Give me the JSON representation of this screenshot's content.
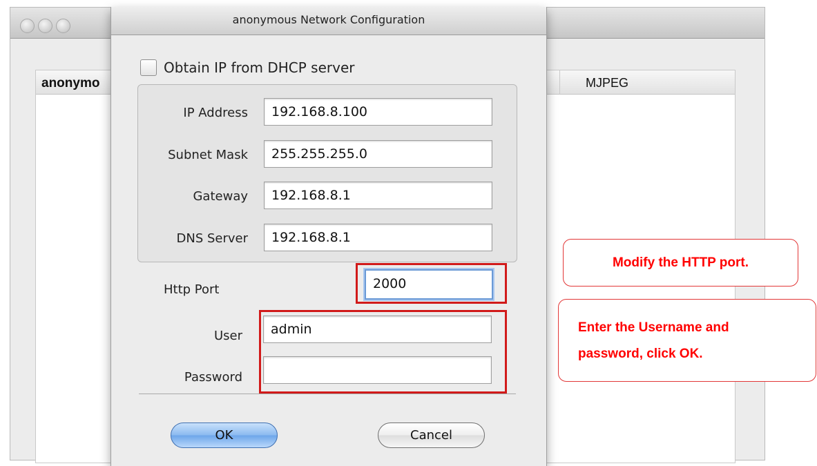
{
  "background_window": {
    "device_name": "anonymo",
    "format_column": "MJPEG"
  },
  "dialog": {
    "title": "anonymous Network Configuration",
    "dhcp_checkbox": {
      "label": "Obtain IP from DHCP server",
      "checked": false
    },
    "fields": {
      "ip_address": {
        "label": "IP Address",
        "value": "192.168.8.100"
      },
      "subnet_mask": {
        "label": "Subnet Mask",
        "value": "255.255.255.0"
      },
      "gateway": {
        "label": "Gateway",
        "value": "192.168.8.1"
      },
      "dns_server": {
        "label": "DNS Server",
        "value": "192.168.8.1"
      },
      "http_port": {
        "label": "Http Port",
        "value": "2000"
      },
      "user": {
        "label": "User",
        "value": "admin"
      },
      "password": {
        "label": "Password",
        "value": ""
      }
    },
    "buttons": {
      "ok": "OK",
      "cancel": "Cancel"
    }
  },
  "annotations": {
    "http_port_note": "Modify the HTTP port.",
    "credentials_note_line1": "Enter the Username and",
    "credentials_note_line2": "password, click OK.",
    "color": "#ff0000"
  }
}
